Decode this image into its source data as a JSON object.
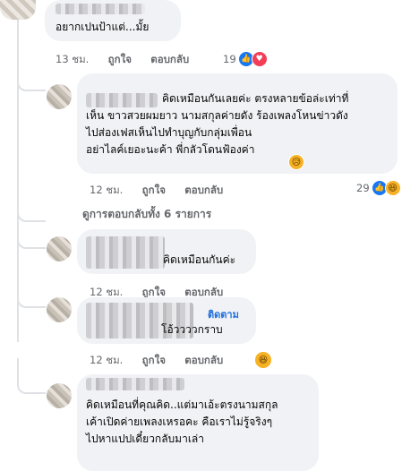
{
  "comments": [
    {
      "text": "อยากเปนป้าแต่...มั้ย",
      "time": "13 ชม.",
      "like": "ถูกใจ",
      "reply": "ตอบกลับ",
      "reactions": "19"
    },
    {
      "text": "คิดเหมือนกันเลยค่ะ ตรงหลายข้อล่ะเท่าที่\nเห็น ขาวสวยผมยาว นามสกุลค่ายดัง ร้องเพลงโหนข่าวดัง\nไปส่องเฟสเห็นไปทำบุญกับกลุ่มเพื่อน\nอย่าไลค์เยอะนะค้า พี่กลัวโดนฟ้องค่า",
      "time": "12 ชม.",
      "like": "ถูกใจ",
      "reply": "ตอบกลับ",
      "reactions": "29"
    },
    {
      "text": "คิดเหมือนกันค่ะ",
      "time": "12 ชม.",
      "like": "ถูกใจ",
      "reply": "ตอบกลับ"
    },
    {
      "text": "โอ้ววววกราบ",
      "follow": "ติดตาม",
      "time": "12 ชม.",
      "like": "ถูกใจ",
      "reply": "ตอบกลับ"
    },
    {
      "text": "คิดเหมือนที่คุณคิด..แต่มาเอ้ะตรงนามสกุล\nเค้าเปิดค่ายเพลงเหรอคะ คือเราไม่รู้จริงๆ\nไปหาแปปเดี๋ยวกลับมาเล่า"
    }
  ],
  "view_all_replies": "ดูการตอบกลับทั้ง 6 รายการ",
  "icons": {
    "like": "like-icon",
    "love": "love-icon",
    "haha": "haha-icon",
    "sad": "sad-icon"
  },
  "colors": {
    "bubble": "#f0f2f5",
    "link": "#216fdb",
    "meta": "#65676b",
    "like": "#1877f2"
  }
}
